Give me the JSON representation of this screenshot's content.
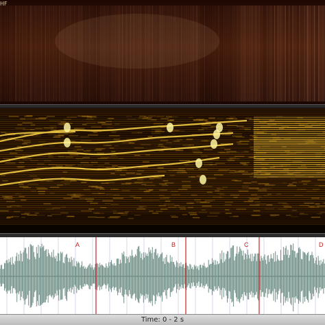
{
  "top_panel": {
    "label": "HF"
  },
  "markers": [
    {
      "label": "A"
    },
    {
      "label": "B"
    },
    {
      "label": "C"
    },
    {
      "label": "D"
    }
  ],
  "time_bar": {
    "label": "Time: 0 - 2 s"
  },
  "colors": {
    "hf_background": "#2a0d05",
    "spectrogram_low": "#1a0a00",
    "spectrogram_high": "#ffe34a",
    "waveform": "#6f8f86",
    "marker_line": "#cc2222",
    "grid_line": "#9aa0c8"
  }
}
